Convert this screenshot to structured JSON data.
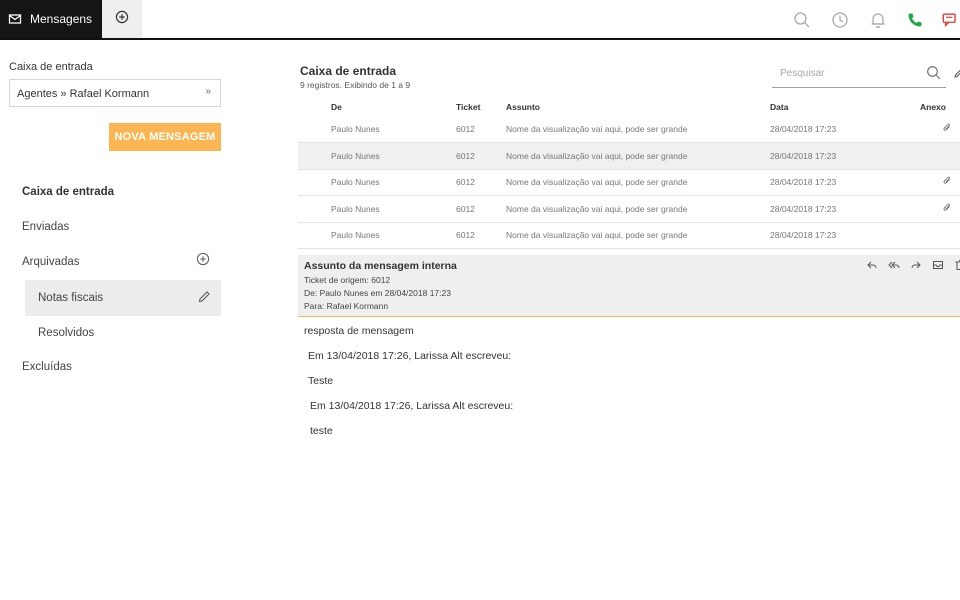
{
  "topbar": {
    "active_tab_label": "Mensagens",
    "icons": [
      "envelope-icon",
      "plus-circle-icon",
      "search-icon",
      "clock-icon",
      "bell-icon",
      "phone-icon",
      "chat-icon"
    ],
    "colors": {
      "bar_bg": "#151515",
      "phone": "#22a64a",
      "chat": "#e53935"
    }
  },
  "sidebar": {
    "section_label": "Caixa de entrada",
    "select_value": "Agentes » Rafael Kormann",
    "select_chevron": "»",
    "new_button": "NOVA MENSAGEM",
    "items": [
      {
        "label": "Caixa de entrada"
      },
      {
        "label": "Enviadas"
      },
      {
        "label": "Arquivadas"
      },
      {
        "label": "Notas fiscais"
      },
      {
        "label": "Resolvidos"
      },
      {
        "label": "Excluídas"
      }
    ],
    "accent": "#fbb552"
  },
  "main": {
    "title": "Caixa de entrada",
    "count": "9 registros. Exibindo de 1 a 9",
    "search_placeholder": "Pesquisar",
    "columns": {
      "de": "De",
      "ticket": "Ticket",
      "assunto": "Assunto",
      "data": "Data",
      "anexo": "Anexo"
    },
    "rows": [
      {
        "de": "Paulo Nunes",
        "ticket": "6012",
        "assunto": "Nome da visualização vai aqui, pode ser grande",
        "data": "28/04/2018 17:23",
        "anexo": true
      },
      {
        "de": "Paulo Nunes",
        "ticket": "6012",
        "assunto": "Nome da visualização vai aqui, pode ser grande",
        "data": "28/04/2018 17:23",
        "anexo": false
      },
      {
        "de": "Paulo Nunes",
        "ticket": "6012",
        "assunto": "Nome da visualização vai aqui, pode ser grande",
        "data": "28/04/2018 17:23",
        "anexo": true
      },
      {
        "de": "Paulo Nunes",
        "ticket": "6012",
        "assunto": "Nome da visualização vai aqui, pode ser grande",
        "data": "28/04/2018 17:23",
        "anexo": true
      },
      {
        "de": "Paulo Nunes",
        "ticket": "6012",
        "assunto": "Nome da visualização vai aqui, pode ser grande",
        "data": "28/04/2018 17:23",
        "anexo": false
      }
    ]
  },
  "detail": {
    "subject": "Assunto da mensagem interna",
    "ticket_origin": "Ticket de origem: 6012",
    "from": "De: Paulo Nunes em 28/04/2018 17:23",
    "to": "Para: Rafael Kormann",
    "actions": [
      "reply-icon",
      "reply-all-icon",
      "forward-icon",
      "archive-icon",
      "trash-icon"
    ],
    "body": [
      "resposta de mensagem",
      "Em 13/04/2018 17:26, Larissa Alt escreveu:",
      "Teste",
      "Em 13/04/2018 17:26, Larissa Alt escreveu:",
      "teste"
    ]
  }
}
